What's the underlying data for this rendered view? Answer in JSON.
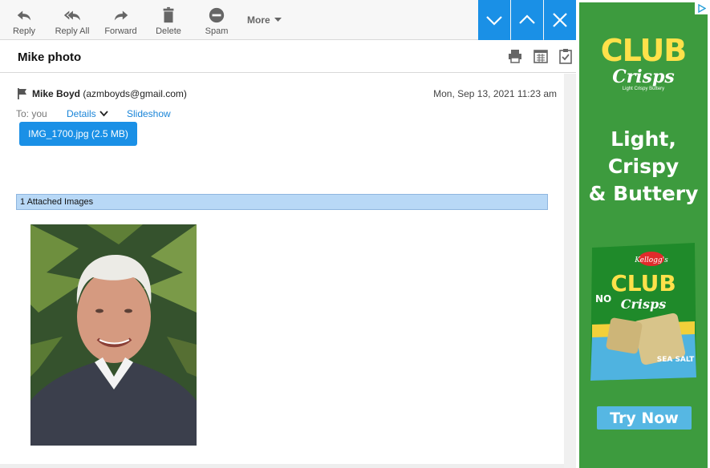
{
  "toolbar": {
    "reply_label": "Reply",
    "reply_all_label": "Reply All",
    "forward_label": "Forward",
    "delete_label": "Delete",
    "spam_label": "Spam",
    "more_label": "More"
  },
  "subject": "Mike photo",
  "message": {
    "from_name": "Mike Boyd",
    "from_email": "(azmboyds@gmail.com)",
    "date": "Mon, Sep 13, 2021 11:23 am",
    "to_label": "To: you",
    "details_label": "Details",
    "slideshow_label": "Slideshow",
    "attachment_label": "IMG_1700.jpg (2.5 MB)",
    "attached_bar": "1 Attached Images"
  },
  "ad": {
    "brand_line1": "CLUB",
    "brand_line2": "Crisps",
    "brand_tag": "Light Crispy Buttery",
    "headline": [
      "Light,",
      "Crispy",
      "& Buttery"
    ],
    "package_brand": "Kellogg's",
    "package_flag": "NO",
    "package_flavor": "SEA SALT",
    "cta": "Try Now"
  },
  "colors": {
    "accent": "#1a90e6",
    "ad_background": "#3d9b3e",
    "ad_logo": "#ffe14a",
    "ad_cta": "#56b7e3"
  }
}
